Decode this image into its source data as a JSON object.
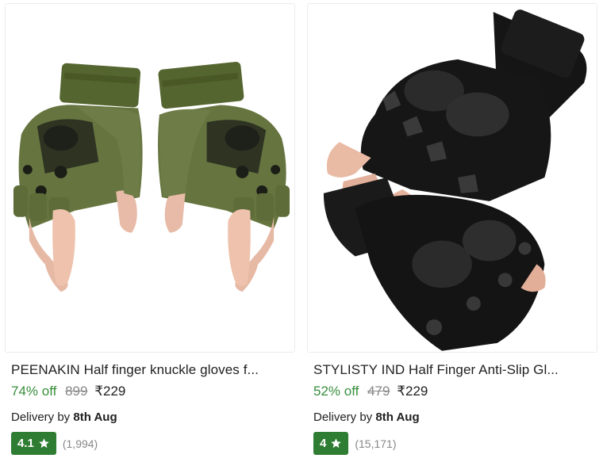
{
  "products": [
    {
      "title": "PEENAKIN Half finger knuckle gloves f...",
      "discount": "74% off",
      "mrp": "899",
      "price": "₹229",
      "delivery_prefix": "Delivery by",
      "delivery_date": "8th Aug",
      "rating": "4.1",
      "rating_count": "(1,994)",
      "image_subject": "olive green tactical half-finger gloves",
      "icon": "star-icon"
    },
    {
      "title": "STYLISTY IND Half Finger Anti-Slip Gl...",
      "discount": "52% off",
      "mrp": "479",
      "price": "₹229",
      "delivery_prefix": "Delivery by",
      "delivery_date": "8th Aug",
      "rating": "4",
      "rating_count": "(15,171)",
      "image_subject": "black tactical half-finger gloves",
      "icon": "star-icon"
    }
  ],
  "colors": {
    "discount_green": "#388e3c",
    "rating_badge_green": "#2e7d32",
    "muted_text": "#878787",
    "glove_olive": "#5b6b3a",
    "glove_black": "#141414"
  }
}
